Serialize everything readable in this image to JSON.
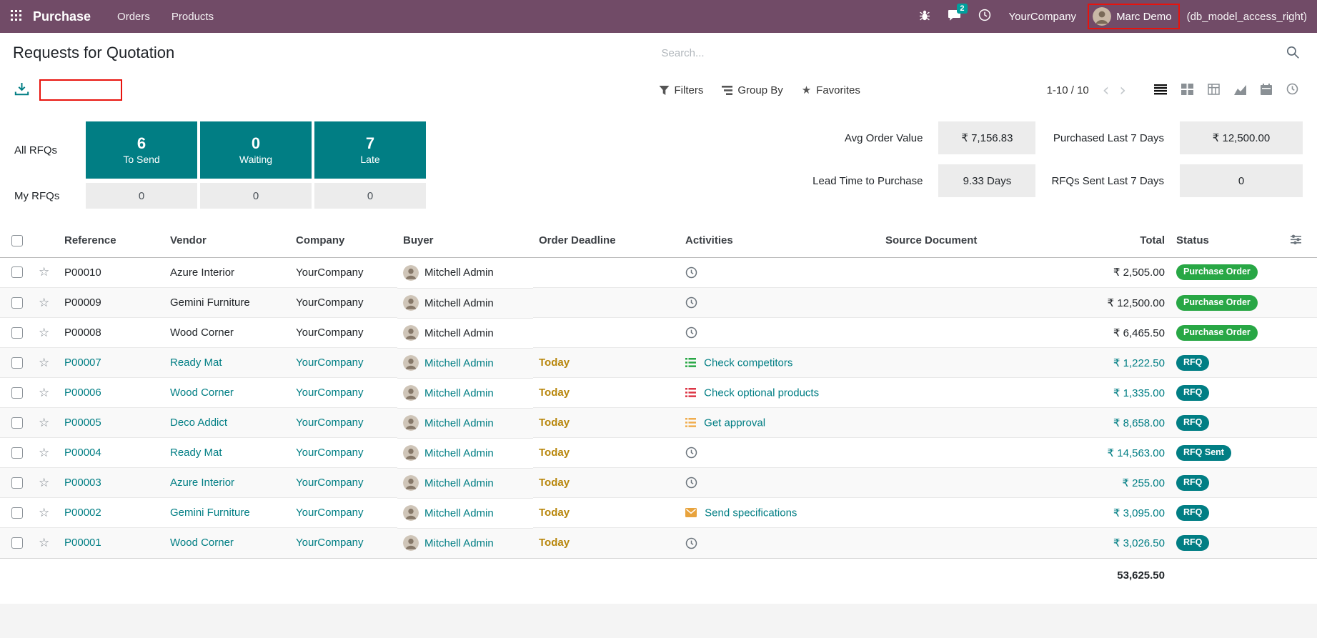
{
  "colors": {
    "navbar_bg": "#714B67",
    "primary": "#017e84",
    "success": "#28a745",
    "warning": "#b8860b",
    "badge": "#00a09d",
    "annotation": "#e8130d"
  },
  "glyphs": {
    "star_outline": "☆",
    "star_filled": "★",
    "pager_prev": "‹",
    "pager_next": "›"
  },
  "navbar": {
    "app_name": "Purchase",
    "menus": [
      {
        "label": "Orders"
      },
      {
        "label": "Products"
      }
    ],
    "right": {
      "message_badge": "2",
      "company": "YourCompany",
      "user": "Marc Demo",
      "suffix": "(db_model_access_right)"
    }
  },
  "breadcrumb": {
    "title": "Requests for Quotation"
  },
  "search": {
    "placeholder": "Search..."
  },
  "control": {
    "filters": "Filters",
    "group_by": "Group By",
    "favorites": "Favorites",
    "pager": "1-10 / 10"
  },
  "dashboard": {
    "row_labels": [
      "All RFQs",
      "My RFQs"
    ],
    "cards": [
      {
        "value": "6",
        "label": "To Send",
        "my_value": "0"
      },
      {
        "value": "0",
        "label": "Waiting",
        "my_value": "0"
      },
      {
        "value": "7",
        "label": "Late",
        "my_value": "0"
      }
    ],
    "stats": [
      {
        "label": "Avg Order Value",
        "value": "₹ 7,156.83"
      },
      {
        "label": "Purchased Last 7 Days",
        "value": "₹ 12,500.00"
      },
      {
        "label": "Lead Time to Purchase",
        "value": "9.33 Days"
      },
      {
        "label": "RFQs Sent Last 7 Days",
        "value": "0"
      }
    ]
  },
  "table": {
    "columns": [
      "Reference",
      "Vendor",
      "Company",
      "Buyer",
      "Order Deadline",
      "Activities",
      "Source Document",
      "Total",
      "Status"
    ],
    "rows": [
      {
        "reference": "P00010",
        "vendor": "Azure Interior",
        "company": "YourCompany",
        "buyer": "Mitchell Admin",
        "deadline": "",
        "activity": "",
        "activity_icon": "clock",
        "activity_color": "#6c757d",
        "source": "",
        "total": "₹ 2,505.00",
        "status": "Purchase Order",
        "status_type": "po",
        "highlight": false
      },
      {
        "reference": "P00009",
        "vendor": "Gemini Furniture",
        "company": "YourCompany",
        "buyer": "Mitchell Admin",
        "deadline": "",
        "activity": "",
        "activity_icon": "clock",
        "activity_color": "#6c757d",
        "source": "",
        "total": "₹ 12,500.00",
        "status": "Purchase Order",
        "status_type": "po",
        "highlight": false
      },
      {
        "reference": "P00008",
        "vendor": "Wood Corner",
        "company": "YourCompany",
        "buyer": "Mitchell Admin",
        "deadline": "",
        "activity": "",
        "activity_icon": "clock",
        "activity_color": "#6c757d",
        "source": "",
        "total": "₹ 6,465.50",
        "status": "Purchase Order",
        "status_type": "po",
        "highlight": false
      },
      {
        "reference": "P00007",
        "vendor": "Ready Mat",
        "company": "YourCompany",
        "buyer": "Mitchell Admin",
        "deadline": "Today",
        "activity": "Check competitors",
        "activity_icon": "tasks",
        "activity_color": "#28a745",
        "source": "",
        "total": "₹ 1,222.50",
        "status": "RFQ",
        "status_type": "rfq",
        "highlight": true
      },
      {
        "reference": "P00006",
        "vendor": "Wood Corner",
        "company": "YourCompany",
        "buyer": "Mitchell Admin",
        "deadline": "Today",
        "activity": "Check optional products",
        "activity_icon": "tasks",
        "activity_color": "#dc3545",
        "source": "",
        "total": "₹ 1,335.00",
        "status": "RFQ",
        "status_type": "rfq",
        "highlight": true
      },
      {
        "reference": "P00005",
        "vendor": "Deco Addict",
        "company": "YourCompany",
        "buyer": "Mitchell Admin",
        "deadline": "Today",
        "activity": "Get approval",
        "activity_icon": "tasks",
        "activity_color": "#f0ad4e",
        "source": "",
        "total": "₹ 8,658.00",
        "status": "RFQ",
        "status_type": "rfq",
        "highlight": true
      },
      {
        "reference": "P00004",
        "vendor": "Ready Mat",
        "company": "YourCompany",
        "buyer": "Mitchell Admin",
        "deadline": "Today",
        "activity": "",
        "activity_icon": "clock",
        "activity_color": "#6c757d",
        "source": "",
        "total": "₹ 14,563.00",
        "status": "RFQ Sent",
        "status_type": "rfq",
        "highlight": true
      },
      {
        "reference": "P00003",
        "vendor": "Azure Interior",
        "company": "YourCompany",
        "buyer": "Mitchell Admin",
        "deadline": "Today",
        "activity": "",
        "activity_icon": "clock",
        "activity_color": "#6c757d",
        "source": "",
        "total": "₹ 255.00",
        "status": "RFQ",
        "status_type": "rfq",
        "highlight": true
      },
      {
        "reference": "P00002",
        "vendor": "Gemini Furniture",
        "company": "YourCompany",
        "buyer": "Mitchell Admin",
        "deadline": "Today",
        "activity": "Send specifications",
        "activity_icon": "envelope",
        "activity_color": "#e8a33d",
        "source": "",
        "total": "₹ 3,095.00",
        "status": "RFQ",
        "status_type": "rfq",
        "highlight": true
      },
      {
        "reference": "P00001",
        "vendor": "Wood Corner",
        "company": "YourCompany",
        "buyer": "Mitchell Admin",
        "deadline": "Today",
        "activity": "",
        "activity_icon": "clock",
        "activity_color": "#6c757d",
        "source": "",
        "total": "₹ 3,026.50",
        "status": "RFQ",
        "status_type": "rfq",
        "highlight": true
      }
    ],
    "footer_total": "53,625.50"
  }
}
